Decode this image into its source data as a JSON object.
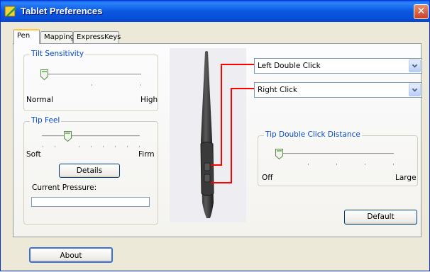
{
  "window": {
    "title": "Tablet Preferences",
    "close_glyph": "✕"
  },
  "tabs": [
    {
      "label": "Pen",
      "active": true
    },
    {
      "label": "Mapping",
      "active": false
    },
    {
      "label": "ExpressKeys",
      "active": false
    }
  ],
  "tilt_sensitivity": {
    "title": "Tilt Sensitivity",
    "min_label": "Normal",
    "max_label": "High",
    "level": 0.05
  },
  "tip_feel": {
    "title": "Tip Feel",
    "min_label": "Soft",
    "max_label": "Firm",
    "level": 0.28,
    "details_label": "Details",
    "current_pressure_label": "Current Pressure:",
    "pressure_value": 0
  },
  "side_switch": {
    "upper_value": "Left Double Click",
    "lower_value": "Right Click"
  },
  "tip_double_click": {
    "title": "Tip Double Click Distance",
    "min_label": "Off",
    "max_label": "Large",
    "level": 0.0
  },
  "buttons": {
    "default_label": "Default",
    "about_label": "About"
  },
  "colors": {
    "group_title": "#0046d5",
    "callout_line": "#ff0000",
    "tab_highlight": "#ffc83c"
  }
}
